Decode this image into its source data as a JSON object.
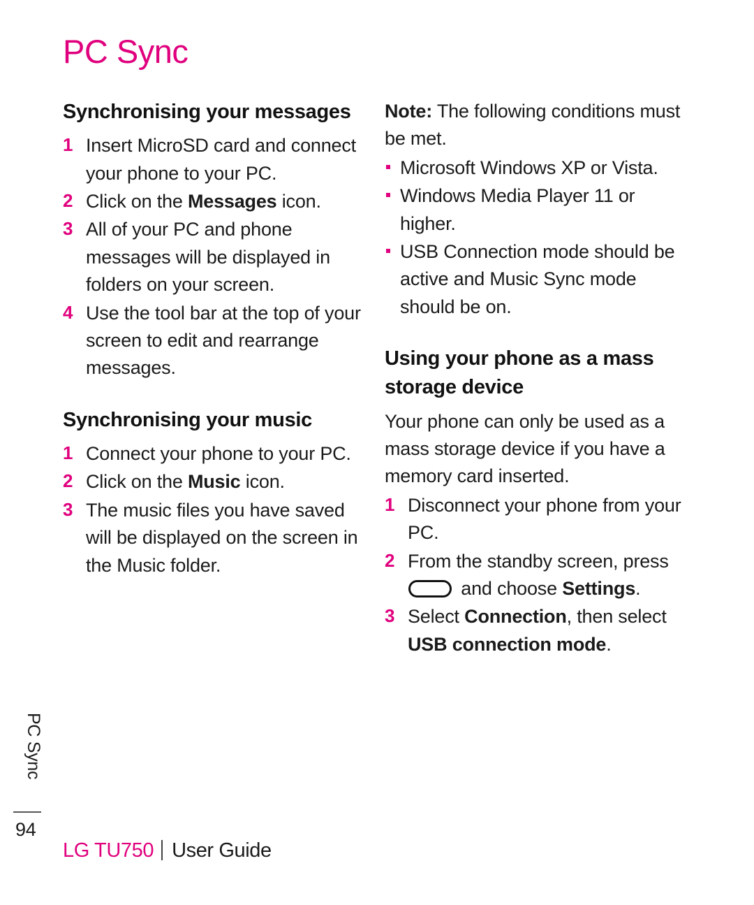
{
  "document": {
    "title": "PC Sync",
    "page_number": "94",
    "side_tab_label": "PC Sync",
    "footer": {
      "brand": "LG TU750",
      "separator": "|",
      "guide_label": "User Guide"
    },
    "accent_color": "#e0007d",
    "text_color": "#1a1a1a"
  },
  "left_column": {
    "heading_1": "Synchronising your messages",
    "steps_1": [
      {
        "num": "1",
        "text": "Insert MicroSD card and connect your phone to your PC."
      },
      {
        "num": "2",
        "pre": "Click on the ",
        "bold": "Messages",
        "post": " icon."
      },
      {
        "num": "3",
        "text": "All of your PC and phone messages will be displayed in folders on your screen."
      },
      {
        "num": "4",
        "text": "Use the tool bar at the top of your screen to edit and rearrange messages."
      }
    ],
    "heading_2": "Synchronising your music",
    "steps_2": [
      {
        "num": "1",
        "text": "Connect your phone to your PC."
      },
      {
        "num": "2",
        "pre": "Click on the ",
        "bold": "Music",
        "post": " icon."
      },
      {
        "num": "3",
        "text": "The music files you have saved will be displayed on the screen in the Music folder."
      }
    ]
  },
  "right_column": {
    "note_label": "Note:",
    "note_text": " The following conditions must be met.",
    "conditions": [
      "Microsoft Windows XP or Vista.",
      "Windows Media Player 11 or higher.",
      "USB Connection mode should be active and Music Sync mode should be on."
    ],
    "heading_1": "Using your phone as a mass storage device",
    "intro_paragraph": "Your phone can only be used as a mass storage device if you have a memory card inserted.",
    "steps": [
      {
        "num": "1",
        "text": "Disconnect your phone from your PC."
      },
      {
        "num": "2",
        "pre": "From the standby screen, press ",
        "icon": "hardware-key-icon",
        "mid": " and choose ",
        "bold": "Settings",
        "post": "."
      },
      {
        "num": "3",
        "pre": "Select ",
        "bold": "Connection",
        "mid": ", then select ",
        "bold2": "USB connection mode",
        "post": "."
      }
    ]
  }
}
